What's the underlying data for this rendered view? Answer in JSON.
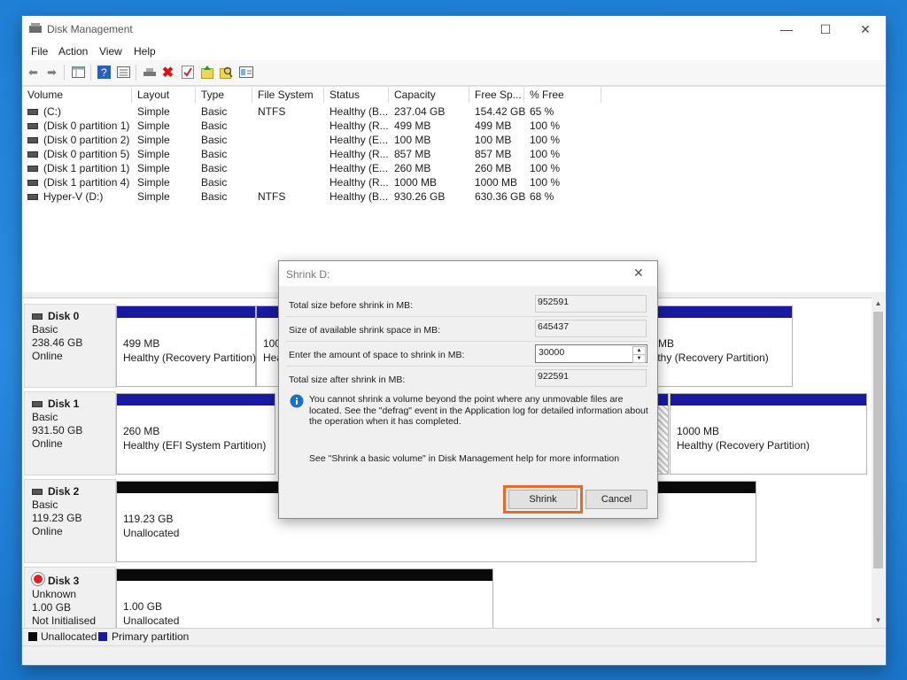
{
  "window": {
    "title": "Disk Management"
  },
  "menu": [
    "File",
    "Action",
    "View",
    "Help"
  ],
  "toolbar": [
    "back-icon",
    "forward-icon",
    "properties-grid-icon",
    "help-icon",
    "refresh-list-icon",
    "connect-icon",
    "delete-icon",
    "checkmark-icon",
    "up-icon",
    "search-icon",
    "import-icon"
  ],
  "volume_table": {
    "headers": [
      "Volume",
      "Layout",
      "Type",
      "File System",
      "Status",
      "Capacity",
      "Free Sp...",
      "% Free"
    ],
    "rows": [
      [
        "(C:)",
        "Simple",
        "Basic",
        "NTFS",
        "Healthy (B...",
        "237.04 GB",
        "154.42 GB",
        "65 %"
      ],
      [
        "(Disk 0 partition 1)",
        "Simple",
        "Basic",
        "",
        "Healthy (R...",
        "499 MB",
        "499 MB",
        "100 %"
      ],
      [
        "(Disk 0 partition 2)",
        "Simple",
        "Basic",
        "",
        "Healthy (E...",
        "100 MB",
        "100 MB",
        "100 %"
      ],
      [
        "(Disk 0 partition 5)",
        "Simple",
        "Basic",
        "",
        "Healthy (R...",
        "857 MB",
        "857 MB",
        "100 %"
      ],
      [
        "(Disk 1 partition 1)",
        "Simple",
        "Basic",
        "",
        "Healthy (E...",
        "260 MB",
        "260 MB",
        "100 %"
      ],
      [
        "(Disk 1 partition 4)",
        "Simple",
        "Basic",
        "",
        "Healthy (R...",
        "1000 MB",
        "1000 MB",
        "100 %"
      ],
      [
        "Hyper-V (D:)",
        "Simple",
        "Basic",
        "NTFS",
        "Healthy (B...",
        "930.26 GB",
        "630.36 GB",
        "68 %"
      ]
    ]
  },
  "disks": [
    {
      "name": "Disk 0",
      "type": "Basic",
      "size": "238.46 GB",
      "state": "Online",
      "partitions": [
        {
          "size": "499 MB",
          "desc": "Healthy (Recovery Partition)"
        },
        {
          "size": "100",
          "desc": "Hea"
        },
        {
          "size": "7 MB",
          "desc": "althy (Recovery Partition)"
        }
      ]
    },
    {
      "name": "Disk 1",
      "type": "Basic",
      "size": "931.50 GB",
      "state": "Online",
      "partitions": [
        {
          "size": "260 MB",
          "desc": "Healthy (EFI System Partition)"
        },
        {
          "size": "1000 MB",
          "desc": "Healthy (Recovery Partition)"
        }
      ]
    },
    {
      "name": "Disk 2",
      "type": "Basic",
      "size": "119.23 GB",
      "state": "Online",
      "partitions": [
        {
          "size": "119.23 GB",
          "desc": "Unallocated"
        }
      ]
    },
    {
      "name": "Disk 3",
      "type": "Unknown",
      "size": "1.00 GB",
      "state": "Not Initialised",
      "partitions": [
        {
          "size": "1.00 GB",
          "desc": "Unallocated"
        }
      ]
    }
  ],
  "legend": {
    "unallocated": "Unallocated",
    "primary": "Primary partition"
  },
  "dialog": {
    "title": "Shrink D:",
    "total_before_label": "Total size before shrink in MB:",
    "total_before_value": "952591",
    "available_label": "Size of available shrink space in MB:",
    "available_value": "645437",
    "amount_label": "Enter the amount of space to shrink in MB:",
    "amount_value": "30000",
    "total_after_label": "Total size after shrink in MB:",
    "total_after_value": "922591",
    "info_text": "You cannot shrink a volume beyond the point where any unmovable files are located. See the \"defrag\" event in the Application log for detailed information about the operation when it has completed.",
    "help_text": "See \"Shrink a basic volume\" in Disk Management help for more information",
    "shrink_label": "Shrink",
    "cancel_label": "Cancel"
  },
  "colors": {
    "primary_partition": "#1a1aa0",
    "unallocated": "#0a0a0a",
    "highlight": "#e8692a",
    "info": "#1e6fc7"
  }
}
